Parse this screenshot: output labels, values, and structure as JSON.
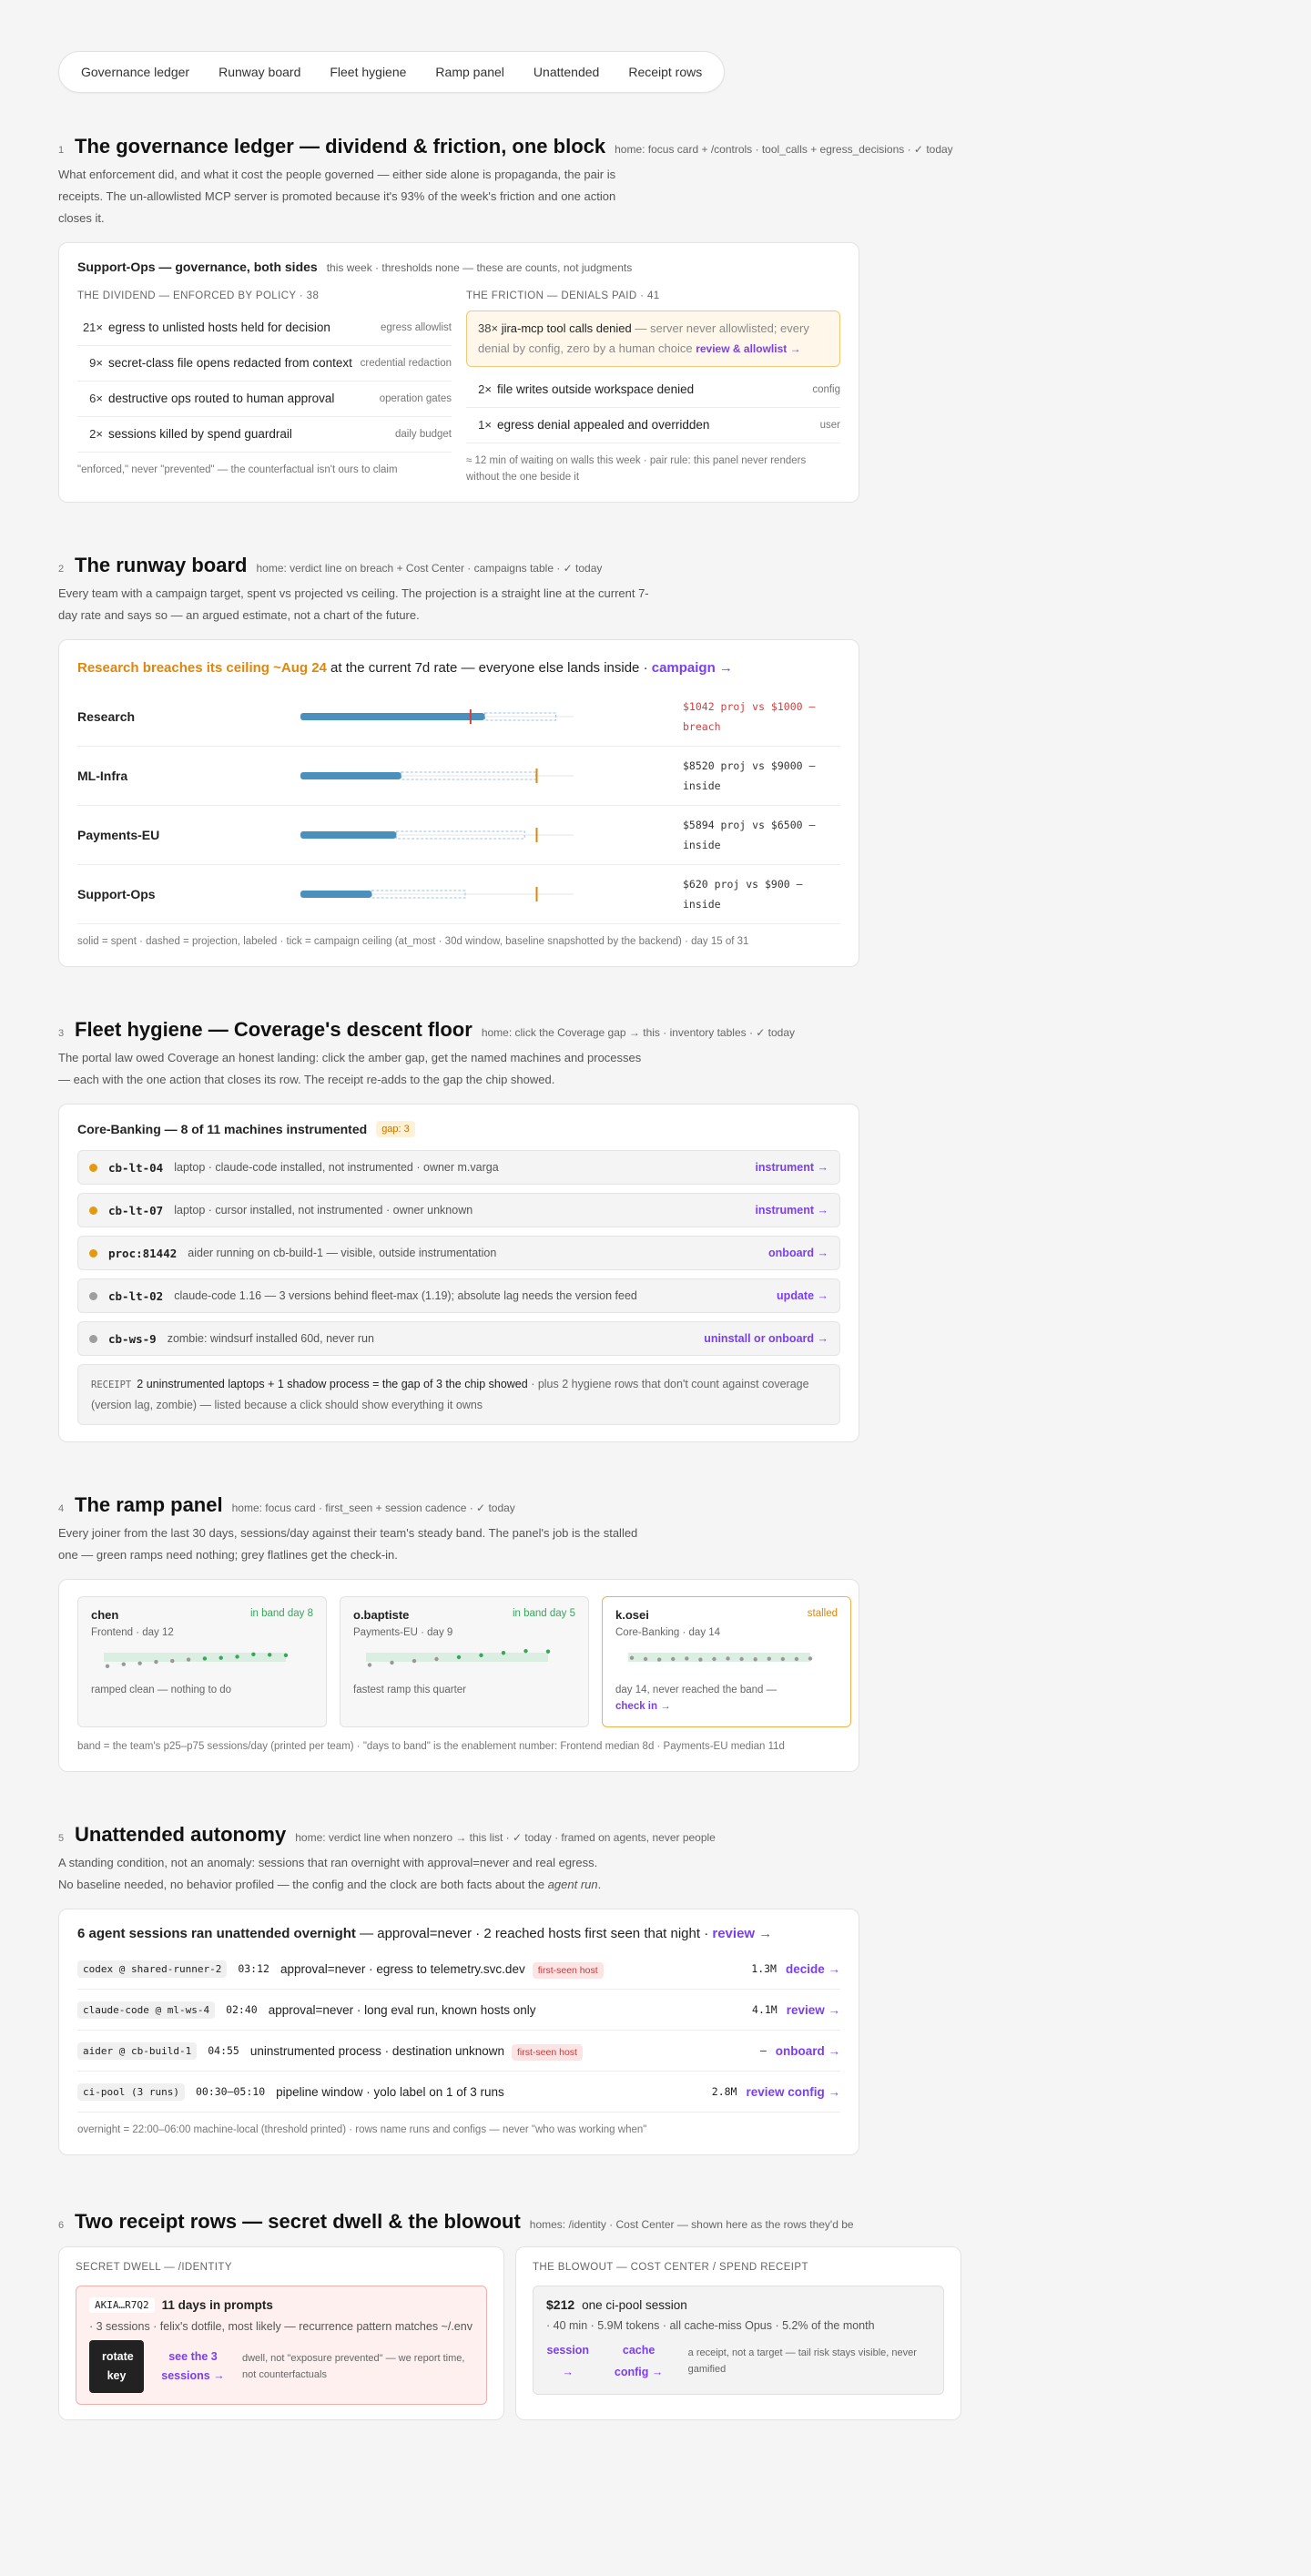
{
  "nav": [
    "Governance ledger",
    "Runway board",
    "Fleet hygiene",
    "Ramp panel",
    "Unattended",
    "Receipt rows"
  ],
  "s1": {
    "num": "1",
    "title": "The governance ledger — dividend & friction, one block",
    "meta": "home: focus card + /controls · tool_calls + egress_decisions · ✓ today",
    "desc": "What enforcement did, and what it cost the people governed — either side alone is propaganda, the pair is receipts. The un-allowlisted MCP server is promoted because it's 93% of the week's friction and one action closes it.",
    "card_title": "Support-Ops — governance, both sides",
    "card_meta": "this week · thresholds none — these are counts, not judgments",
    "dividend_head": "THE DIVIDEND — ENFORCED BY POLICY · 38",
    "dividend": [
      {
        "count": "21×",
        "text": "egress to unlisted hosts held for decision",
        "tag": "egress allowlist"
      },
      {
        "count": "9×",
        "text": "secret-class file opens redacted from context",
        "tag": "credential redaction"
      },
      {
        "count": "6×",
        "text": "destructive ops routed to human approval",
        "tag": "operation gates"
      },
      {
        "count": "2×",
        "text": "sessions killed by spend guardrail",
        "tag": "daily budget"
      }
    ],
    "dividend_foot": "\"enforced,\" never \"prevented\" — the counterfactual isn't ours to claim",
    "friction_head": "THE FRICTION — DENIALS PAID · 41",
    "friction_hl": {
      "count": "38×",
      "main": "jira-mcp tool calls denied",
      "sub": " — server never allowlisted; every denial by config, zero by a human choice ",
      "action": "review & allowlist →"
    },
    "friction": [
      {
        "count": "2×",
        "text": "file writes outside workspace denied",
        "tag": "config"
      },
      {
        "count": "1×",
        "text": "egress denial appealed and overridden",
        "tag": "user"
      }
    ],
    "friction_foot": "≈ 12 min of waiting on walls this week · pair rule: this panel never renders without the one beside it"
  },
  "s2": {
    "num": "2",
    "title": "The runway board",
    "meta": "home: verdict line on breach + Cost Center · campaigns table · ✓ today",
    "desc": "Every team with a campaign target, spent vs projected vs ceiling. The projection is a straight line at the current 7-day rate and says so — an argued estimate, not a chart of the future.",
    "head_warn": "Research breaches its ceiling ~Aug 24",
    "head_rest": " at the current 7d rate — everyone else lands inside · ",
    "head_link": "campaign →",
    "rows": [
      {
        "team": "Research",
        "spent": 0.75,
        "proj": 1.042,
        "note": "$1042 proj vs $1000 — breach",
        "breach": true
      },
      {
        "team": "ML-Infra",
        "spent": 0.41,
        "proj": 0.85,
        "note": "$8520 proj vs $9000 — inside",
        "breach": false
      },
      {
        "team": "Payments-EU",
        "spent": 0.39,
        "proj": 0.81,
        "note": "$5894 proj vs $6500 — inside",
        "breach": false
      },
      {
        "team": "Support-Ops",
        "spent": 0.29,
        "proj": 0.59,
        "note": "$620 proj vs $900 — inside",
        "breach": false
      }
    ],
    "foot": "solid = spent · dashed = projection, labeled · tick = campaign ceiling (at_most · 30d window, baseline snapshotted by the backend) · day 15 of 31"
  },
  "s3": {
    "num": "3",
    "title": "Fleet hygiene — Coverage's descent floor",
    "meta": "home: click the Coverage gap → this · inventory tables · ✓ today",
    "desc": "The portal law owed Coverage an honest landing: click the amber gap, get the named machines and processes — each with the one action that closes its row. The receipt re-adds to the gap the chip showed.",
    "card_title": "Core-Banking — 8 of 11 machines instrumented",
    "badge": "gap: 3",
    "rows": [
      {
        "host": "cb-lt-04",
        "desc": "laptop · claude-code installed, not instrumented · owner m.varga",
        "action": "instrument →",
        "color": "#e39a12"
      },
      {
        "host": "cb-lt-07",
        "desc": "laptop · cursor installed, not instrumented · owner unknown",
        "action": "instrument →",
        "color": "#e39a12"
      },
      {
        "host": "proc:81442",
        "desc": "aider running on cb-build-1 — visible, outside instrumentation",
        "action": "onboard →",
        "color": "#e39a12"
      },
      {
        "host": "cb-lt-02",
        "desc": "claude-code 1.16 — 3 versions behind fleet-max (1.19); absolute lag needs the version feed",
        "action": "update →",
        "color": "#9e9e9e"
      },
      {
        "host": "cb-ws-9",
        "desc": "zombie: windsurf installed 60d, never run",
        "action": "uninstall or onboard →",
        "color": "#9e9e9e"
      }
    ],
    "receipt_label": "RECEIPT",
    "receipt_main": "2 uninstrumented laptops + 1 shadow process = the gap of 3 the chip showed",
    "receipt_rest": " · plus 2 hygiene rows that don't count against coverage (version lag, zombie) — listed because a click should show everything it owns"
  },
  "s4": {
    "num": "4",
    "title": "The ramp panel",
    "meta": "home: focus card · first_seen + session cadence · ✓ today",
    "desc": "Every joiner from the last 30 days, sessions/day against their team's steady band. The panel's job is the stalled one — green ramps need nothing; grey flatlines get the check-in.",
    "cards": [
      {
        "name": "chen",
        "status": "in band day 8",
        "sub": "Frontend · day 12",
        "note": "ramped clean — nothing to do",
        "stall": false,
        "pts": [
          0.2,
          0.28,
          0.32,
          0.38,
          0.42,
          0.48,
          0.52,
          0.55,
          0.6,
          0.7,
          0.68,
          0.66
        ]
      },
      {
        "name": "o.baptiste",
        "status": "in band day 5",
        "sub": "Payments-EU · day 9",
        "note": "fastest ramp this quarter",
        "stall": false,
        "pts": [
          0.25,
          0.35,
          0.42,
          0.5,
          0.58,
          0.66,
          0.76,
          0.84,
          0.82
        ]
      },
      {
        "name": "k.osei",
        "status": "stalled",
        "sub": "Core-Banking · day 14",
        "note": "day 14, never reached the band —",
        "link": "check in →",
        "stall": true,
        "pts": [
          0.55,
          0.5,
          0.48,
          0.5,
          0.52,
          0.48,
          0.5,
          0.52,
          0.5,
          0.49,
          0.51,
          0.5,
          0.5,
          0.52
        ]
      }
    ],
    "foot": "band = the team's p25–p75 sessions/day (printed per team) · \"days to band\" is the enablement number: Frontend median 8d · Payments-EU median 11d"
  },
  "s5": {
    "num": "5",
    "title": "Unattended autonomy",
    "meta": "home: verdict line when nonzero → this list · ✓ today · framed on agents, never people",
    "desc1": "A standing condition, not an anomaly: sessions that ran overnight with approval=never and real egress.",
    "desc2a": "No baseline needed, no behavior profiled — the config and the clock are both facts about the ",
    "desc2b": "agent run",
    "desc2c": ".",
    "head_main": "6 agent sessions ran unattended overnight",
    "head_rest": " — approval=never · 2 reached hosts first seen that night · ",
    "head_link": "review →",
    "rows": [
      {
        "chip": "codex @ shared-runner-2",
        "time": "03:12",
        "desc": "approval=never · egress to telemetry.svc.dev",
        "flag": "first-seen host",
        "tok": "1.3M",
        "action": "decide →"
      },
      {
        "chip": "claude-code @ ml-ws-4",
        "time": "02:40",
        "desc": "approval=never · long eval run, known hosts only",
        "flag": "",
        "tok": "4.1M",
        "action": "review →"
      },
      {
        "chip": "aider @ cb-build-1",
        "time": "04:55",
        "desc": "uninstrumented process · destination unknown",
        "flag": "first-seen host",
        "tok": "–",
        "action": "onboard →"
      },
      {
        "chip": "ci-pool (3 runs)",
        "time": "00:30–05:10",
        "desc": "pipeline window · yolo label on 1 of 3 runs",
        "flag": "",
        "tok": "2.8M",
        "action": "review config →"
      }
    ],
    "foot": "overnight = 22:00–06:00 machine-local (threshold printed) · rows name runs and configs — never \"who was working when\""
  },
  "s6": {
    "num": "6",
    "title": "Two receipt rows — secret dwell & the blowout",
    "meta": "homes: /identity · Cost Center — shown here as the rows they'd be",
    "left_head": "SECRET DWELL — /IDENTITY",
    "key": "AKIA…R7Q2",
    "dwell": "11 days in prompts",
    "dwell_sub": "· 3 sessions · felix's dotfile, most likely — recurrence pattern matches ~/.env",
    "btn": "rotate key",
    "link": "see the 3 sessions →",
    "note": "dwell, not \"exposure prevented\" — we report time, not counterfactuals",
    "right_head": "THE BLOWOUT — COST CENTER / SPEND RECEIPT",
    "amount": "$212",
    "amount_label": "one ci-pool session",
    "amount_sub": "· 40 min · 5.9M tokens · all cache-miss Opus · 5.2% of the month",
    "l1": "session →",
    "l2": "cache config →",
    "note2": "a receipt, not a target — tail risk stays visible, never gamified"
  }
}
